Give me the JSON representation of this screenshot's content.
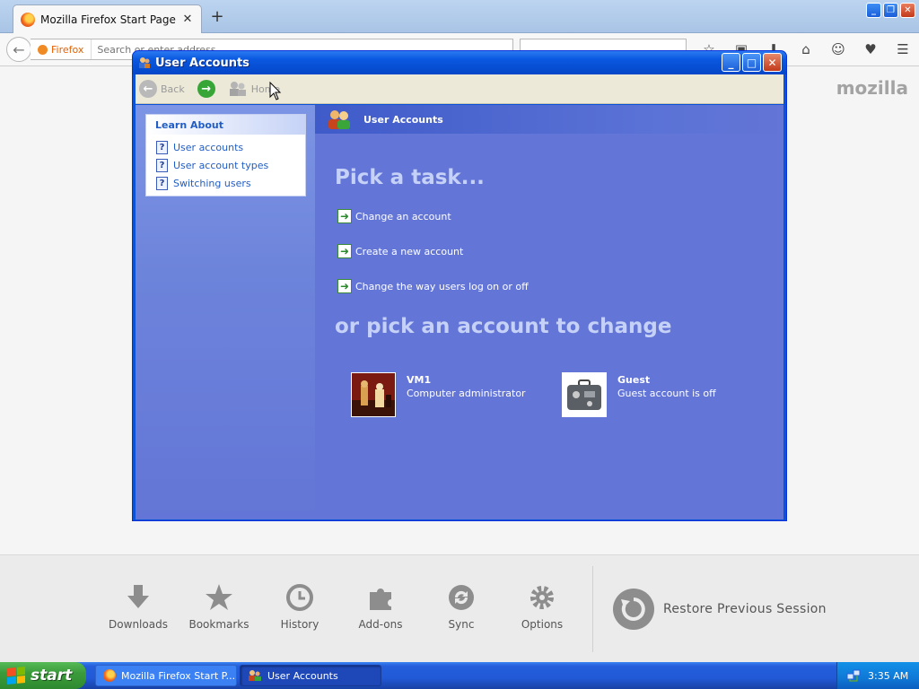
{
  "firefox": {
    "tab_title": "Mozilla Firefox Start Page",
    "new_tab_symbol": "+",
    "identity_label": "Firefox",
    "url_placeholder": "Search or enter address",
    "search_placeholder": "Search",
    "brand_word": "mozilla",
    "launcher": [
      {
        "label": "Downloads",
        "icon": "download-icon"
      },
      {
        "label": "Bookmarks",
        "icon": "star-icon"
      },
      {
        "label": "History",
        "icon": "clock-icon"
      },
      {
        "label": "Add-ons",
        "icon": "puzzle-icon"
      },
      {
        "label": "Sync",
        "icon": "sync-icon"
      },
      {
        "label": "Options",
        "icon": "gear-icon"
      }
    ],
    "restore_label": "Restore Previous Session"
  },
  "ua_window": {
    "title": "User Accounts",
    "toolbar": {
      "back_label": "Back",
      "home_label": "Home"
    },
    "learn_about": {
      "heading": "Learn About",
      "items": [
        "User accounts",
        "User account types",
        "Switching users"
      ]
    },
    "header_title": "User Accounts",
    "pick_task_heading": "Pick a task...",
    "tasks": [
      "Change an account",
      "Create a new account",
      "Change the way users log on or off"
    ],
    "pick_account_heading": "or pick an account to change",
    "accounts": [
      {
        "name": "VM1",
        "description": "Computer administrator"
      },
      {
        "name": "Guest",
        "description": "Guest account is off"
      }
    ]
  },
  "taskbar": {
    "start_label": "start",
    "buttons": [
      {
        "label": "Mozilla Firefox Start P..."
      },
      {
        "label": "User Accounts"
      }
    ],
    "clock": "3:35 AM"
  },
  "colors": {
    "xp_blue": "#0a53d8",
    "panel_blue": "#6375d6",
    "link_white": "#ffffff",
    "start_green": "#3b9b3b"
  }
}
